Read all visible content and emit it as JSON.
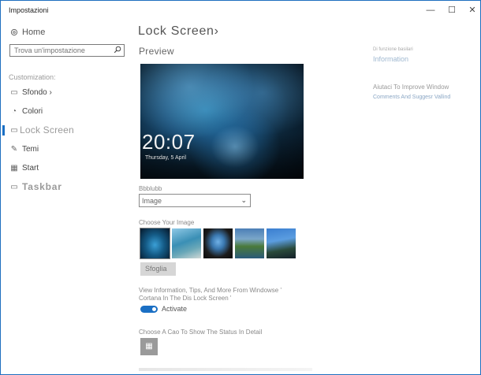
{
  "window": {
    "title": "Impostazioni",
    "minimize_glyph": "—",
    "maximize_glyph": "☐",
    "close_glyph": "✕"
  },
  "sidebar": {
    "home_label": "Home",
    "search_placeholder": "Trova un'impostazione",
    "section_label": "Customization:",
    "items": [
      {
        "label": "Sfondo ›",
        "icon": "image-icon"
      },
      {
        "label": "Colori",
        "icon": "palette-icon"
      },
      {
        "label": "Lock Screen",
        "icon": "lock-screen-icon"
      },
      {
        "label": "Temi",
        "icon": "themes-icon"
      },
      {
        "label": "Start",
        "icon": "start-icon"
      },
      {
        "label": "Taskbar",
        "icon": "taskbar-icon"
      }
    ]
  },
  "main": {
    "page_title": "Lock Screen›",
    "preview_title": "Preview",
    "preview_time": "20:07",
    "preview_date": "Thursday, 5 April",
    "background_label": "Bbblubb",
    "background_value": "Image",
    "choose_label": "Choose Your Image",
    "browse_label": "Sfoglia",
    "info_label": "View Information, Tips, And More From Windowse ' Cortana In The Dis Lock Screen '",
    "toggle_label": "Activate",
    "toggle_on": true,
    "status_label": "Choose A Cao To Show The Status In Detail"
  },
  "right": {
    "small_label": "Di funzione basilari",
    "info_link": "Information",
    "help_label": "Aiutaci To Improve Window",
    "comments_label": "Comments And Suggesr Vallind"
  },
  "colors": {
    "accent": "#1a6fc4",
    "window_border": "#1f6fbf"
  }
}
